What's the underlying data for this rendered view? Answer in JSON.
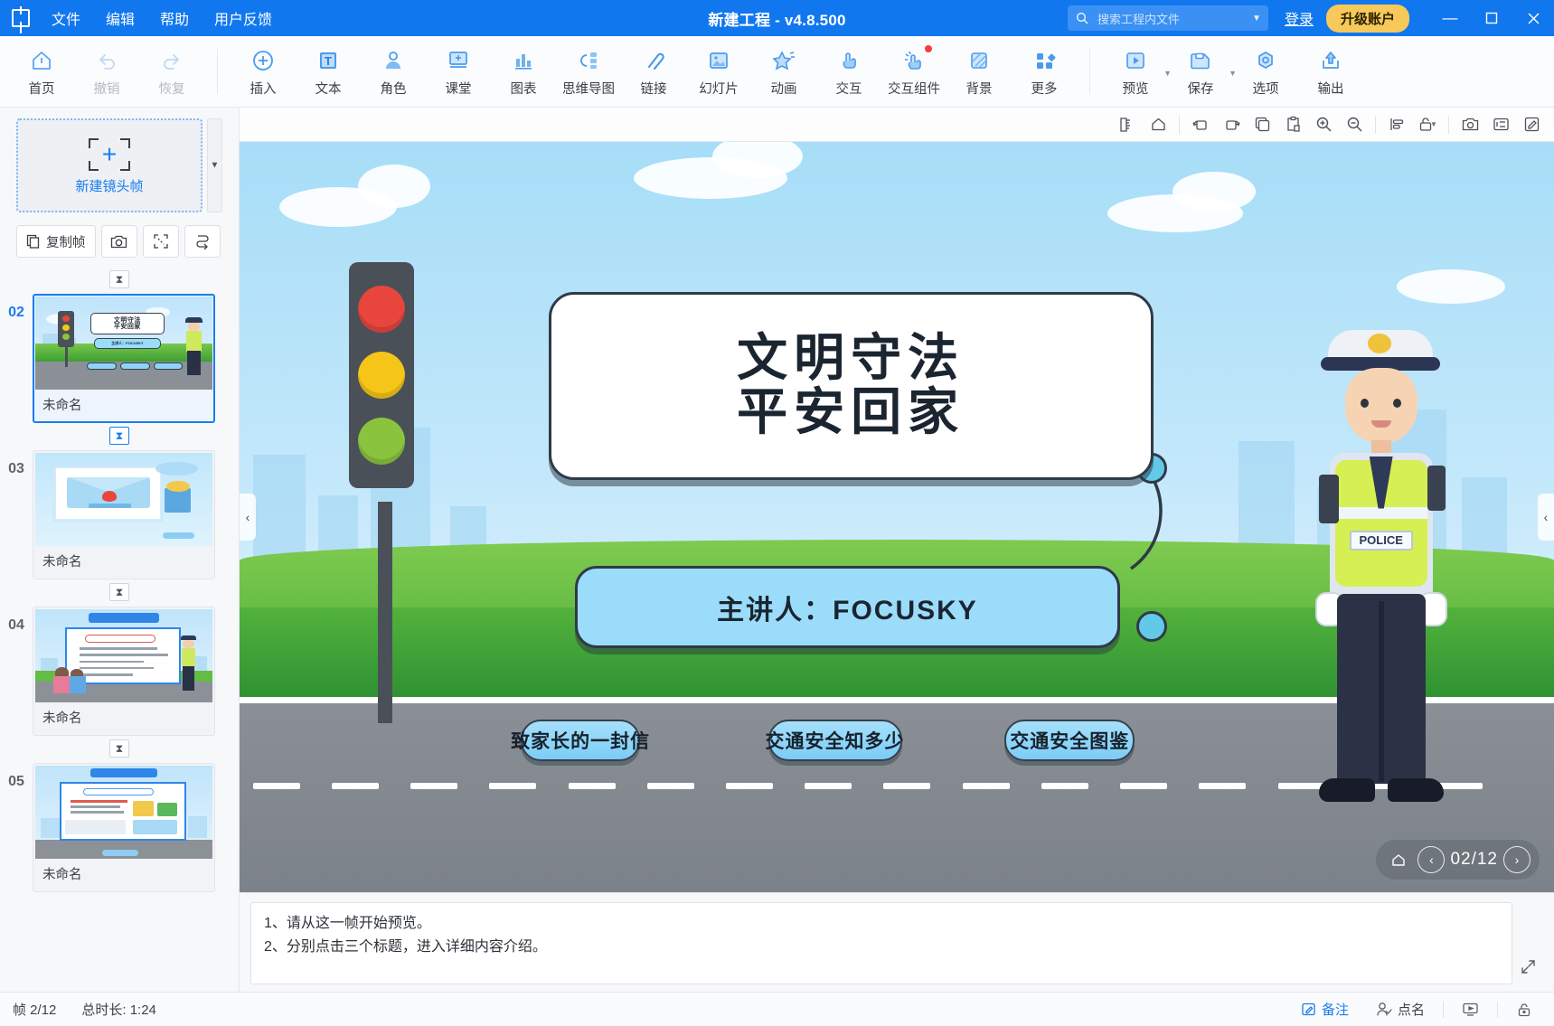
{
  "window": {
    "title": "新建工程 - v4.8.500",
    "app_icon": "focusky-logo-icon",
    "menus": [
      "文件",
      "编辑",
      "帮助",
      "用户反馈"
    ],
    "search_placeholder": "搜索工程内文件",
    "login_label": "登录",
    "upgrade_label": "升级账户",
    "minimize": "—",
    "maximize": "▢",
    "close": "✕"
  },
  "ribbon": {
    "groups": [
      {
        "items": [
          {
            "label": "首页",
            "icon": "home-icon",
            "disabled": false,
            "caret": false,
            "badge": false
          },
          {
            "label": "撤销",
            "icon": "undo-icon",
            "disabled": true,
            "caret": false,
            "badge": false
          },
          {
            "label": "恢复",
            "icon": "redo-icon",
            "disabled": true,
            "caret": false,
            "badge": false
          }
        ]
      },
      {
        "items": [
          {
            "label": "插入",
            "icon": "plus-circle-icon",
            "disabled": false,
            "caret": false,
            "badge": false
          },
          {
            "label": "文本",
            "icon": "text-box-icon",
            "disabled": false,
            "caret": false,
            "badge": false
          },
          {
            "label": "角色",
            "icon": "character-icon",
            "disabled": false,
            "caret": false,
            "badge": false
          },
          {
            "label": "课堂",
            "icon": "classroom-icon",
            "disabled": false,
            "caret": false,
            "badge": false
          },
          {
            "label": "图表",
            "icon": "chart-icon",
            "disabled": false,
            "caret": false,
            "badge": false
          },
          {
            "label": "思维导图",
            "icon": "mindmap-icon",
            "disabled": false,
            "caret": false,
            "badge": false
          },
          {
            "label": "链接",
            "icon": "link-icon",
            "disabled": false,
            "caret": false,
            "badge": false
          },
          {
            "label": "幻灯片",
            "icon": "slide-icon",
            "disabled": false,
            "caret": false,
            "badge": false
          },
          {
            "label": "动画",
            "icon": "animation-star-icon",
            "disabled": false,
            "caret": false,
            "badge": false
          },
          {
            "label": "交互",
            "icon": "interaction-hand-icon",
            "disabled": false,
            "caret": false,
            "badge": false
          },
          {
            "label": "交互组件",
            "icon": "interactive-component-icon",
            "disabled": false,
            "caret": false,
            "badge": true
          },
          {
            "label": "背景",
            "icon": "background-icon",
            "disabled": false,
            "caret": false,
            "badge": false
          },
          {
            "label": "更多",
            "icon": "more-grid-icon",
            "disabled": false,
            "caret": false,
            "badge": false
          }
        ]
      },
      {
        "items": [
          {
            "label": "预览",
            "icon": "preview-play-icon",
            "disabled": false,
            "caret": true,
            "badge": false
          },
          {
            "label": "保存",
            "icon": "save-disk-icon",
            "disabled": false,
            "caret": true,
            "badge": false
          },
          {
            "label": "选项",
            "icon": "options-gear-icon",
            "disabled": false,
            "caret": false,
            "badge": false
          },
          {
            "label": "输出",
            "icon": "export-upload-icon",
            "disabled": false,
            "caret": false,
            "badge": false
          }
        ]
      }
    ]
  },
  "left_panel": {
    "new_frame_label": "新建镜头帧",
    "tools": [
      {
        "label": "复制帧",
        "icon": "copy-frame-icon"
      },
      {
        "label": "",
        "icon": "camera-icon"
      },
      {
        "label": "",
        "icon": "fit-frame-icon"
      },
      {
        "label": "",
        "icon": "reorder-path-icon"
      }
    ],
    "transition_icon": "hourglass-icon",
    "frames": [
      {
        "number": "02",
        "name": "未命名",
        "selected": true,
        "thumb": "slide-title"
      },
      {
        "number": "03",
        "name": "未命名",
        "selected": false,
        "thumb": "slide-letter"
      },
      {
        "number": "04",
        "name": "未命名",
        "selected": false,
        "thumb": "slide-doc"
      },
      {
        "number": "05",
        "name": "未命名",
        "selected": false,
        "thumb": "slide-doc2"
      }
    ]
  },
  "canvas_toolbar": {
    "buttons": [
      {
        "icon": "ruler-icon"
      },
      {
        "icon": "home-outline-icon"
      },
      {
        "icon": "rotate-left-icon"
      },
      {
        "icon": "rotate-right-icon"
      },
      {
        "icon": "duplicate-icon"
      },
      {
        "icon": "paste-icon"
      },
      {
        "icon": "zoom-in-icon"
      },
      {
        "icon": "zoom-out-icon"
      },
      {
        "icon": "align-icon"
      },
      {
        "icon": "lock-icon"
      },
      {
        "icon": "screenshot-icon"
      },
      {
        "icon": "slide-frame-icon"
      },
      {
        "icon": "edit-icon"
      }
    ]
  },
  "slide": {
    "title_lines": [
      "文明守法",
      "平安回家"
    ],
    "subtitle": "主讲人：FOCUSKY",
    "nav_pills": [
      "致家长的一封信",
      "交通安全知多少",
      "交通安全图鉴"
    ],
    "officer_badge": "POLICE",
    "page_indicator": "02/12",
    "page_home_icon": "home-icon",
    "page_prev_icon": "chevron-left-icon",
    "page_next_icon": "chevron-right-icon",
    "colors": {
      "sky": "#a7ddf7",
      "grass": "#53b23c",
      "road": "#8b9097",
      "accent_blue": "#9bdcfb",
      "traffic_red": "#e8453c",
      "traffic_yellow": "#f5c518",
      "traffic_green": "#8ac43f"
    }
  },
  "notes": {
    "lines": [
      "1、请从这一帧开始预览。",
      "2、分别点击三个标题，进入详细内容介绍。"
    ],
    "expand_icon": "expand-icon"
  },
  "status_bar": {
    "frame_counter": "帧 2/12",
    "total_duration": "总时长: 1:24",
    "notes_label": "备注",
    "rollcall_label": "点名",
    "notes_icon": "note-edit-icon",
    "rollcall_icon": "user-check-icon",
    "present_icon": "presentation-icon",
    "lock_icon": "lock-small-icon"
  }
}
